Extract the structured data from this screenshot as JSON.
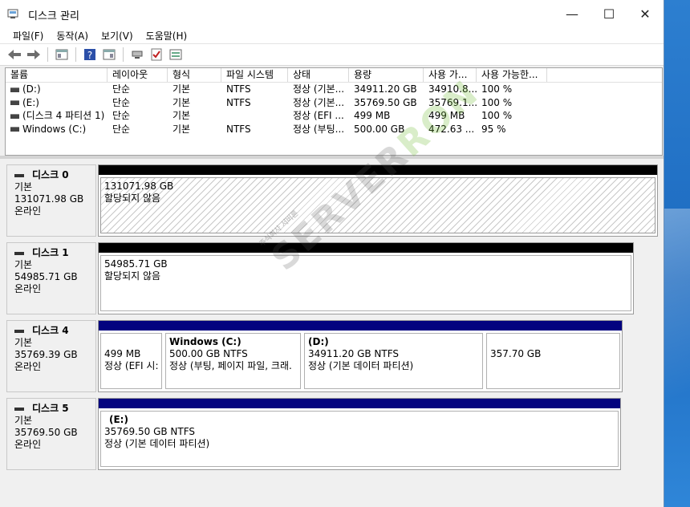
{
  "window": {
    "title": "디스크 관리"
  },
  "controls": {
    "minimize": "—",
    "maximize": "☐",
    "close": "✕"
  },
  "menu": [
    "파일(F)",
    "동작(A)",
    "보기(V)",
    "도움말(H)"
  ],
  "toolbar": [
    "back-icon",
    "forward-icon",
    "console-tree-icon",
    "help-icon",
    "properties-icon",
    "connect-icon",
    "check-icon",
    "settings-icon"
  ],
  "volumes": {
    "headers": [
      "볼륨",
      "레이아웃",
      "형식",
      "파일 시스템",
      "상태",
      "용량",
      "사용 가...",
      "사용 가능한..."
    ],
    "rows": [
      [
        "(D:)",
        "단순",
        "기본",
        "NTFS",
        "정상 (기본...",
        "34911.20 GB",
        "34910.8...",
        "100 %"
      ],
      [
        "(E:)",
        "단순",
        "기본",
        "NTFS",
        "정상 (기본...",
        "35769.50 GB",
        "35769.1...",
        "100 %"
      ],
      [
        "(디스크 4 파티션 1)",
        "단순",
        "기본",
        "",
        "정상 (EFI ...",
        "499 MB",
        "499 MB",
        "100 %"
      ],
      [
        "Windows (C:)",
        "단순",
        "기본",
        "NTFS",
        "정상 (부팅...",
        "500.00 GB",
        "472.63 ...",
        "95 %"
      ]
    ]
  },
  "disks": [
    {
      "name": "디스크 0",
      "type": "기본",
      "size": "131071.98 GB",
      "status": "온라인",
      "partitions": [
        {
          "title": "",
          "size": "131071.98 GB",
          "status": "할당되지 않음",
          "bar": "black",
          "hatched": true
        }
      ]
    },
    {
      "name": "디스크 1",
      "type": "기본",
      "size": "54985.71 GB",
      "status": "온라인",
      "partitions": [
        {
          "title": "",
          "size": "54985.71 GB",
          "status": "할당되지 않음",
          "bar": "black",
          "hatched": false
        }
      ]
    },
    {
      "name": "디스크 4",
      "type": "기본",
      "size": "35769.39 GB",
      "status": "온라인",
      "partitions": [
        {
          "title": "",
          "size": "499 MB",
          "status": "정상 (EFI 시:",
          "bar": "blue"
        },
        {
          "title": "Windows  (C:)",
          "size": "500.00 GB NTFS",
          "status": "정상 (부팅, 페이지 파일, 크래.",
          "bar": "blue"
        },
        {
          "title": "(D:)",
          "size": "34911.20 GB NTFS",
          "status": "정상 (기본 데이터 파티션)",
          "bar": "blue"
        },
        {
          "title": "",
          "size": "357.70 GB",
          "status": "",
          "bar": "blue"
        }
      ]
    },
    {
      "name": "디스크 5",
      "type": "기본",
      "size": "35769.50 GB",
      "status": "온라인",
      "partitions": [
        {
          "title": "(E:)",
          "size": "35769.50 GB NTFS",
          "status": "정상 (기본 데이터 파티션)",
          "bar": "blue"
        }
      ]
    }
  ],
  "watermark": {
    "top": "주식회사 서버론",
    "gray": "SERVER",
    "green": "RON"
  }
}
